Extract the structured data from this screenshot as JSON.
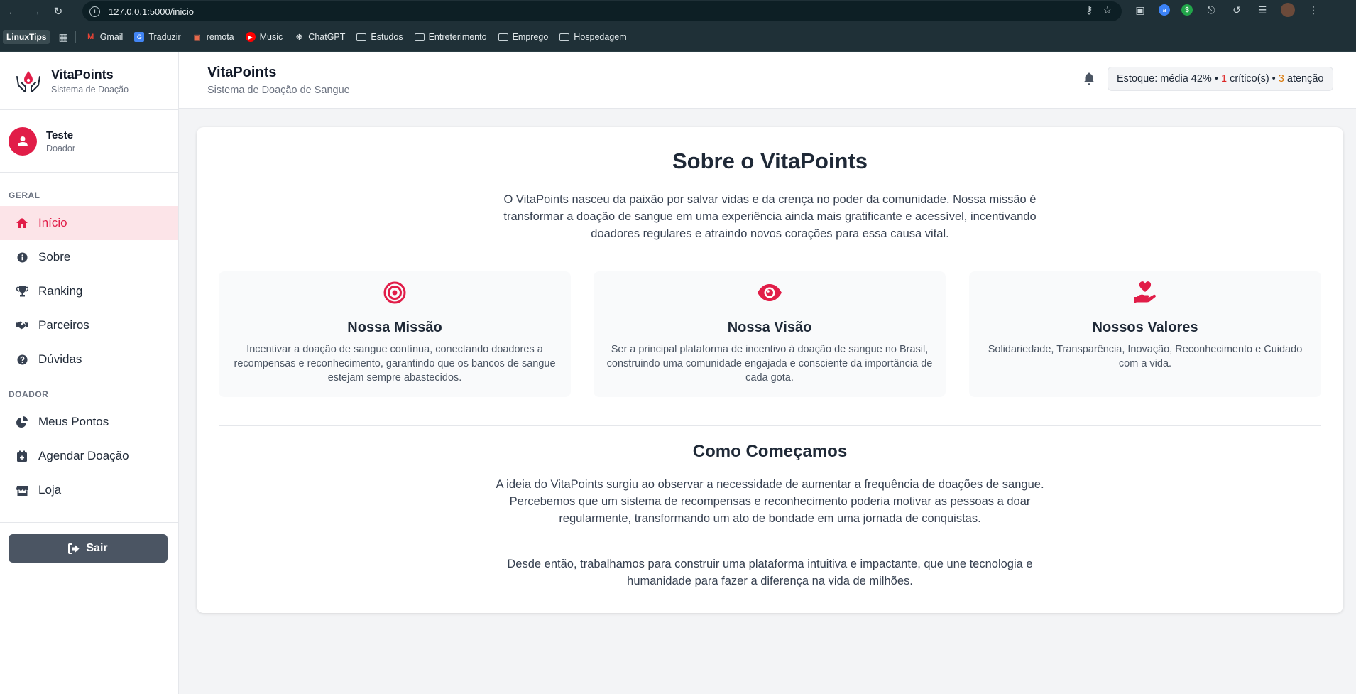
{
  "browser": {
    "url": "127.0.0.1:5000/inicio",
    "bookmarks": [
      {
        "label": "LinuxTips"
      },
      {
        "label": "Gmail"
      },
      {
        "label": "Traduzir"
      },
      {
        "label": "remota"
      },
      {
        "label": "Music"
      },
      {
        "label": "ChatGPT"
      },
      {
        "label": "Estudos"
      },
      {
        "label": "Entreterimento"
      },
      {
        "label": "Emprego"
      },
      {
        "label": "Hospedagem"
      }
    ]
  },
  "sidebar": {
    "brand_title": "VitaPoints",
    "brand_sub": "Sistema de Doação",
    "user_name": "Teste",
    "user_role": "Doador",
    "section_general": "GERAL",
    "section_donor": "DOADOR",
    "items": [
      {
        "label": "Início",
        "icon": "home-icon"
      },
      {
        "label": "Sobre",
        "icon": "info-icon"
      },
      {
        "label": "Ranking",
        "icon": "trophy-icon"
      },
      {
        "label": "Parceiros",
        "icon": "handshake-icon"
      },
      {
        "label": "Dúvidas",
        "icon": "question-icon"
      },
      {
        "label": "Meus Pontos",
        "icon": "pie-chart-icon"
      },
      {
        "label": "Agendar Doação",
        "icon": "calendar-plus-icon"
      },
      {
        "label": "Loja",
        "icon": "store-icon"
      }
    ],
    "logout_label": "Sair"
  },
  "header": {
    "title": "VitaPoints",
    "subtitle": "Sistema de Doação de Sangue",
    "stock_prefix": "Estoque: média 42% •",
    "critical_count": "1",
    "critical_label": "crítico(s) •",
    "attention_count": "3",
    "attention_label": "atenção"
  },
  "main": {
    "title": "Sobre o VitaPoints",
    "intro": "O VitaPoints nasceu da paixão por salvar vidas e da crença no poder da comunidade. Nossa missão é transformar a doação de sangue em uma experiência ainda mais gratificante e acessível, incentivando doadores regulares e atraindo novos corações para essa causa vital.",
    "features": [
      {
        "title": "Nossa Missão",
        "icon": "target-icon",
        "text": "Incentivar a doação de sangue contínua, conectando doadores a recompensas e reconhecimento, garantindo que os bancos de sangue estejam sempre abastecidos."
      },
      {
        "title": "Nossa Visão",
        "icon": "eye-icon",
        "text": "Ser a principal plataforma de incentivo à doação de sangue no Brasil, construindo uma comunidade engajada e consciente da importância de cada gota."
      },
      {
        "title": "Nossos Valores",
        "icon": "hand-holding-heart-icon",
        "text": "Solidariedade, Transparência, Inovação, Reconhecimento e Cuidado com a vida."
      }
    ],
    "story_title": "Como Começamos",
    "story_p1": "A ideia do VitaPoints surgiu ao observar a necessidade de aumentar a frequência de doações de sangue. Percebemos que um sistema de recompensas e reconhecimento poderia motivar as pessoas a doar regularmente, transformando um ato de bondade em uma jornada de conquistas.",
    "story_p2": "Desde então, trabalhamos para construir uma plataforma intuitiva e impactante, que une tecnologia e humanidade para fazer a diferença na vida de milhões."
  },
  "colors": {
    "accent": "#e11d48",
    "active_bg": "#fce4e8",
    "logout_bg": "#4b5563"
  }
}
